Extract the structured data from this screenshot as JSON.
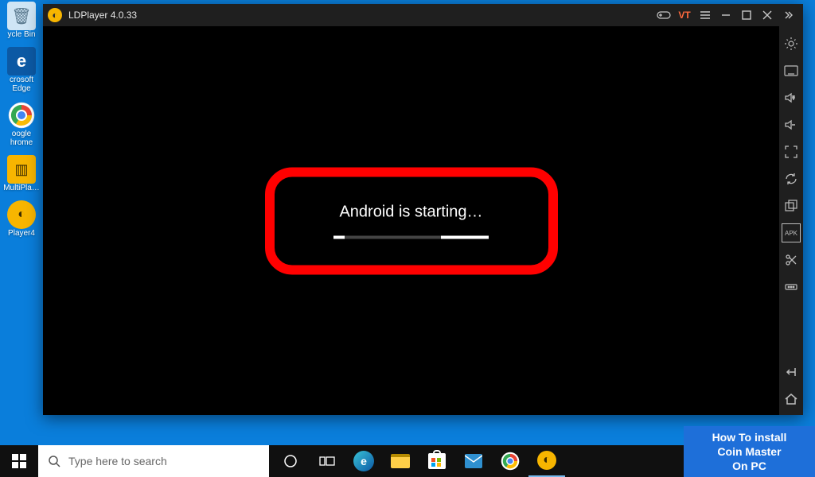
{
  "desktop": {
    "icons": [
      {
        "label": "ycle Bin",
        "iconName": "recycle-bin-icon",
        "bg": "#e6f2fb",
        "glyph": "🗑"
      },
      {
        "label": "crosoft Edge",
        "iconName": "edge-icon",
        "bg": "#0c59a4",
        "glyph": "e"
      },
      {
        "label": "oogle hrome",
        "iconName": "chrome-icon",
        "bg": "#fff",
        "glyph": "⬤"
      },
      {
        "label": "MultiPla…",
        "iconName": "multiplayer-icon",
        "bg": "#f7b500",
        "glyph": "⚡"
      },
      {
        "label": "Player4",
        "iconName": "ldplayer-icon",
        "bg": "#f7b500",
        "glyph": "◐"
      }
    ]
  },
  "window": {
    "title": "LDPlayer 4.0.33",
    "titlebar": {
      "gameControllerIcon": "game-controller-icon",
      "vtLabel": "VT",
      "menuIcon": "menu-icon",
      "minimizeIcon": "minimize-icon",
      "maximizeIcon": "maximize-icon",
      "closeIcon": "close-icon",
      "collapseSidebarIcon": "chevrons-right-icon"
    },
    "viewport": {
      "loadingLabel": "Android is starting…"
    },
    "sidebar": {
      "settingsIcon": "gear-icon",
      "keyboardIcon": "keyboard-icon",
      "volumeUpIcon": "volume-up-icon",
      "volumeDownIcon": "volume-down-icon",
      "fullscreenIcon": "fullscreen-icon",
      "syncIcon": "sync-icon",
      "multiInstanceIcon": "multi-instance-icon",
      "apkLabel": "APK",
      "scissorsIcon": "scissors-icon",
      "moreIcon": "more-horizontal-icon",
      "backIcon": "back-icon",
      "homeIcon": "home-icon"
    }
  },
  "taskbar": {
    "searchPlaceholder": "Type here to search",
    "icons": {
      "start": "windows-start-icon",
      "search": "search-icon",
      "cortana": "circle-outline-icon",
      "taskview": "task-view-icon",
      "edge": "edge-icon",
      "explorer": "file-explorer-icon",
      "store": "store-icon",
      "mail": "mail-icon",
      "chrome": "chrome-icon",
      "ldplayer": "ldplayer-icon"
    }
  },
  "banner": {
    "line1": "How To install",
    "line2": "Coin Master",
    "line3": "On PC"
  }
}
